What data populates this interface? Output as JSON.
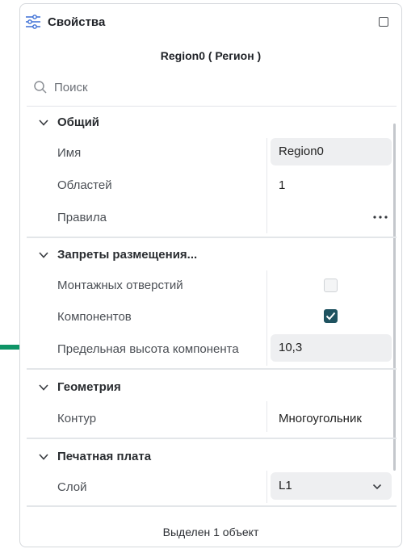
{
  "panel": {
    "title": "Свойства",
    "subtitle": "Region0 ( Регион )",
    "search": {
      "placeholder": "Поиск",
      "value": ""
    },
    "footer": "Выделен 1 объект"
  },
  "sections": {
    "general": {
      "label": "Общий",
      "name_key": "Имя",
      "name_value": "Region0",
      "areas_key": "Областей",
      "areas_value": "1",
      "rules_key": "Правила"
    },
    "placement": {
      "label": "Запреты размещения...",
      "mounting_holes_key": "Монтажных отверстий",
      "mounting_holes_checked": false,
      "components_key": "Компонентов",
      "components_checked": true,
      "max_height_key": "Предельная высота компонента",
      "max_height_value": "10,3"
    },
    "geometry": {
      "label": "Геометрия",
      "contour_key": "Контур",
      "contour_value": "Многоугольник"
    },
    "pcb": {
      "label": "Печатная плата",
      "layer_key": "Слой",
      "layer_value": "L1"
    }
  },
  "colors": {
    "accent_checkbox": "#1f5360",
    "annotation_arrow": "#0e9466",
    "settings_icon": "#3b6fd6"
  },
  "icons": [
    "settings-sliders-icon",
    "maximize-icon",
    "search-icon",
    "chevron-down-icon",
    "more-dots-icon",
    "check-icon",
    "arrow-right-icon"
  ]
}
